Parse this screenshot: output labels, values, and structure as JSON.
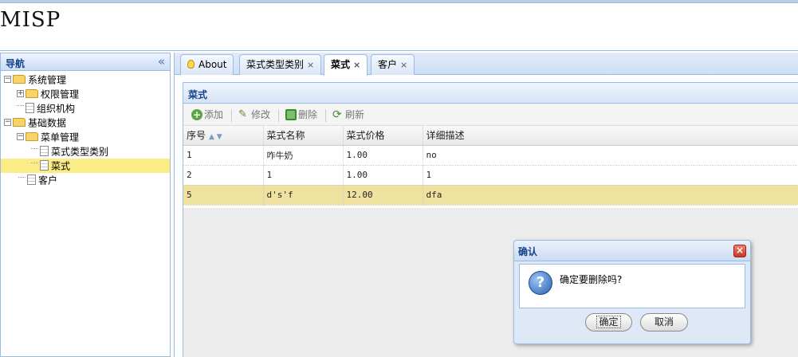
{
  "app": {
    "title": "MISP"
  },
  "nav": {
    "title": "导航",
    "collapse_glyph": "«",
    "tree": [
      {
        "label": "系统管理",
        "expander": "⊟"
      },
      {
        "label": "权限管理",
        "expander": "⊞"
      },
      {
        "label": "组织机构"
      },
      {
        "label": "基础数据",
        "expander": "⊟"
      },
      {
        "label": "菜单管理",
        "expander": "⊟"
      },
      {
        "label": "菜式类型类别"
      },
      {
        "label": "菜式",
        "selected": true
      },
      {
        "label": "客户"
      }
    ]
  },
  "tabs": [
    {
      "label": "About",
      "icon": "lightbulb-icon"
    },
    {
      "label": "菜式类型类别",
      "close": "×"
    },
    {
      "label": "菜式",
      "close": "×",
      "active": true
    },
    {
      "label": "客户",
      "close": "×"
    }
  ],
  "grid": {
    "title": "菜式",
    "toolbar": {
      "add": "添加",
      "edit": "修改",
      "delete": "删除",
      "refresh": "刷新"
    },
    "columns": [
      "序号",
      "菜式名称",
      "菜式价格",
      "详细描述"
    ],
    "sort_glyph": "▲ ▼",
    "rows": [
      [
        "1",
        "咋牛奶",
        "1.00",
        "no"
      ],
      [
        "2",
        "1",
        "1.00",
        "1"
      ],
      [
        "5",
        "d's'f",
        "12.00",
        "dfa"
      ]
    ],
    "selected_row": 2
  },
  "dialog": {
    "title": "确认",
    "close_glyph": "×",
    "icon_glyph": "?",
    "message": "确定要删除吗?",
    "ok": "确定",
    "cancel": "取消"
  },
  "colors": {
    "accent": "#15428b",
    "border": "#99bbe8",
    "selected": "#fbec88"
  }
}
